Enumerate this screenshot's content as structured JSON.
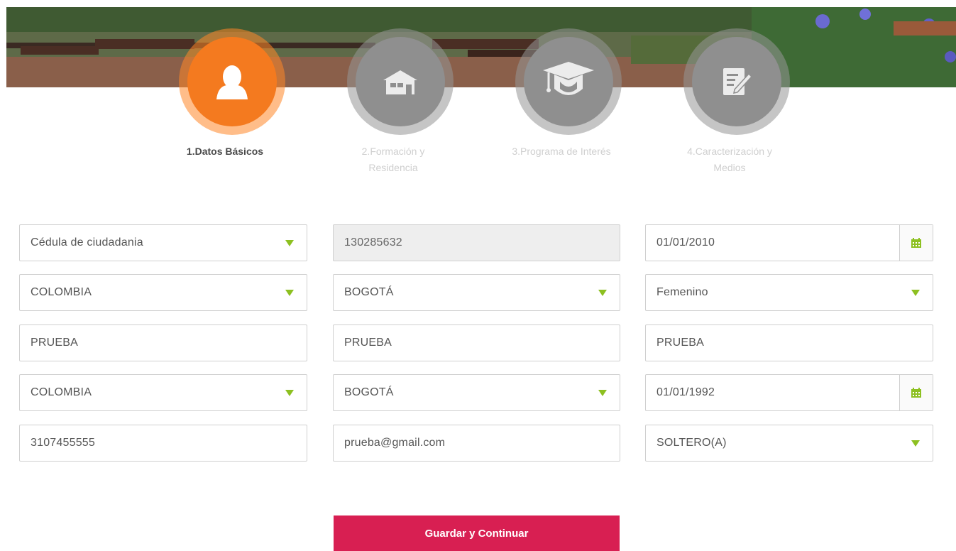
{
  "steps": [
    {
      "label_line1": "1.Datos Básicos",
      "label_line2": "",
      "icon": "user-icon",
      "active": true
    },
    {
      "label_line1": "2.Formación y",
      "label_line2": "Residencia",
      "icon": "house-icon",
      "active": false
    },
    {
      "label_line1": "3.Programa de Interés",
      "label_line2": "",
      "icon": "graduation-cap-icon",
      "active": false
    },
    {
      "label_line1": "4.Caracterización y",
      "label_line2": "Medios",
      "icon": "edit-document-icon",
      "active": false
    }
  ],
  "form": {
    "tipo_documento": "Cédula de ciudadania",
    "numero_documento": "130285632",
    "fecha_expedicion": "01/01/2010",
    "pais_expedicion": "COLOMBIA",
    "ciudad_expedicion": "BOGOTÁ",
    "genero": "Femenino",
    "nombre1": "PRUEBA",
    "nombre2": "PRUEBA",
    "apellido": "PRUEBA",
    "pais_nacimiento": "COLOMBIA",
    "ciudad_nacimiento": "BOGOTÁ",
    "fecha_nacimiento": "01/01/1992",
    "telefono": "3107455555",
    "email": "prueba@gmail.com",
    "estado_civil": "SOLTERO(A)"
  },
  "submit_label": "Guardar y Continuar",
  "colors": {
    "active_step": "#f47a1f",
    "inactive_step": "#8f8f8f",
    "caret": "#8dc021",
    "submit": "#d81f52"
  }
}
